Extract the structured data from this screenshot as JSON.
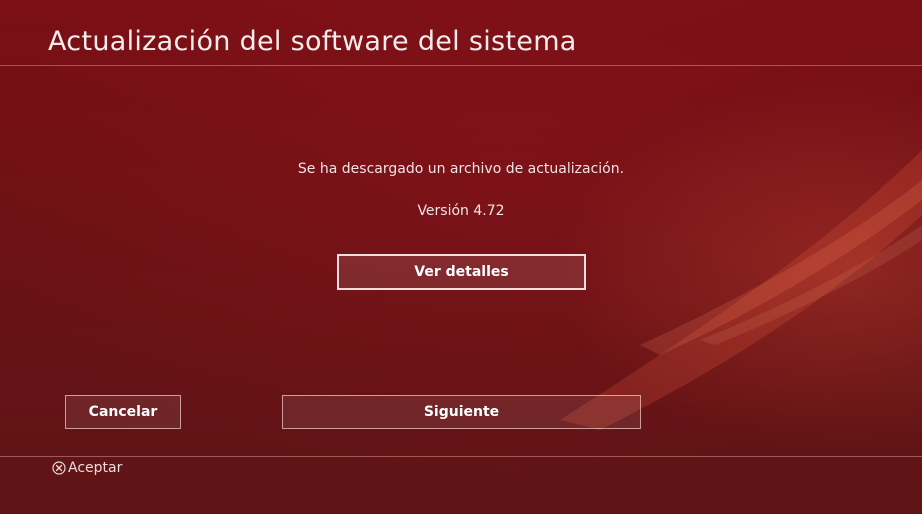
{
  "header": {
    "title": "Actualización del software del sistema"
  },
  "dialog": {
    "message": "Se ha descargado un archivo de actualización.",
    "version": "Versión 4.72",
    "details_button": "Ver detalles"
  },
  "actions": {
    "cancel_label": "Cancelar",
    "next_label": "Siguiente"
  },
  "footer": {
    "hint_icon": "cross-button-icon",
    "hint_label": "Aceptar"
  },
  "theme": {
    "background": "#6c1216",
    "text": "#f4e9e9",
    "accent": "#e65a3c"
  }
}
